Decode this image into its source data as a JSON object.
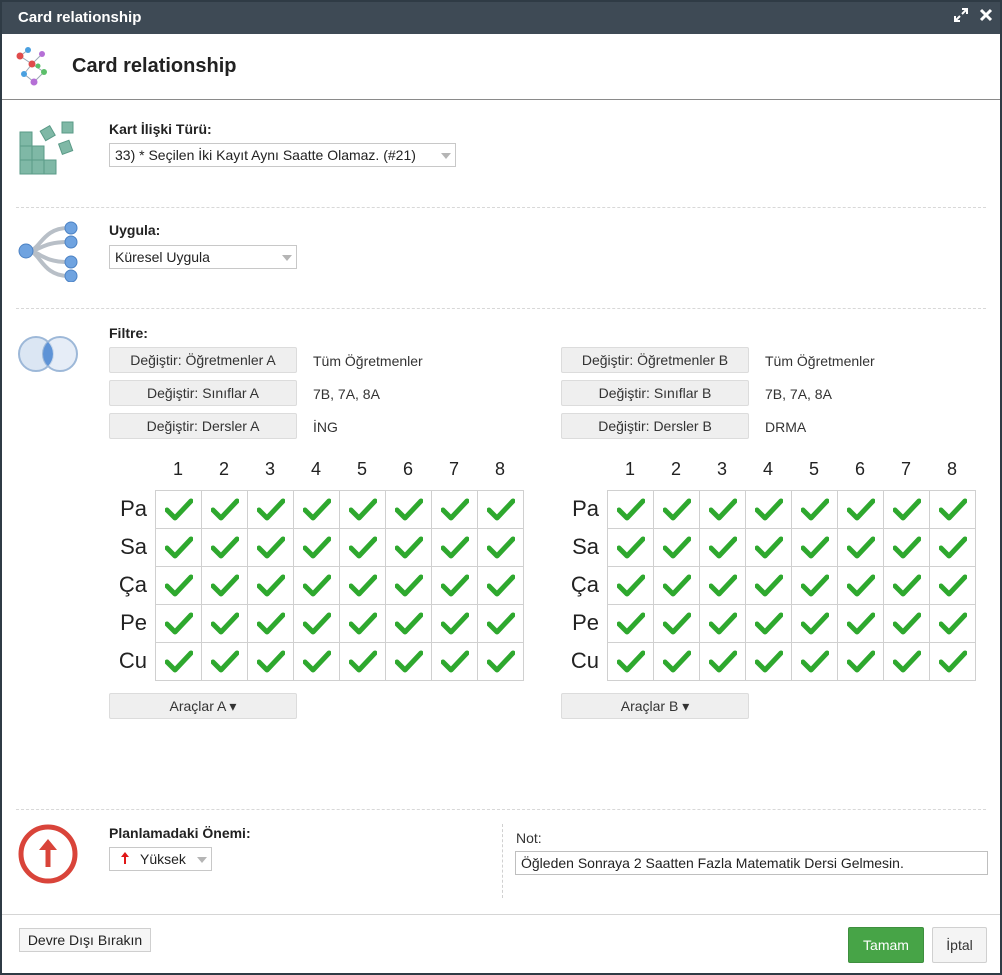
{
  "window": {
    "title": "Card relationship"
  },
  "header": {
    "title": "Card relationship"
  },
  "relation_type": {
    "label": "Kart İlişki Türü:",
    "selected": "33) * Seçilen İki Kayıt Aynı Saatte Olamaz. (#21)"
  },
  "apply": {
    "label": "Uygula:",
    "selected": "Küresel Uygula"
  },
  "filter": {
    "label": "Filtre:",
    "a": {
      "teachers_button": "Değiştir: Öğretmenler A",
      "teachers_value": "Tüm Öğretmenler",
      "classes_button": "Değiştir: Sınıflar A",
      "classes_value": "7B, 7A, 8A",
      "subjects_button": "Değiştir: Dersler A",
      "subjects_value": "İNG",
      "tools_button": "Araçlar A ▾"
    },
    "b": {
      "teachers_button": "Değiştir: Öğretmenler B",
      "teachers_value": "Tüm Öğretmenler",
      "classes_button": "Değiştir: Sınıflar B",
      "classes_value": "7B, 7A, 8A",
      "subjects_button": "Değiştir: Dersler B",
      "subjects_value": "DRMA",
      "tools_button": "Araçlar B ▾"
    }
  },
  "grid": {
    "periods": [
      "1",
      "2",
      "3",
      "4",
      "5",
      "6",
      "7",
      "8"
    ],
    "days": [
      "Pa",
      "Sa",
      "Ça",
      "Pe",
      "Cu"
    ],
    "a_checked": [
      [
        true,
        true,
        true,
        true,
        true,
        true,
        true,
        true
      ],
      [
        true,
        true,
        true,
        true,
        true,
        true,
        true,
        true
      ],
      [
        true,
        true,
        true,
        true,
        true,
        true,
        true,
        true
      ],
      [
        true,
        true,
        true,
        true,
        true,
        true,
        true,
        true
      ],
      [
        true,
        true,
        true,
        true,
        true,
        true,
        true,
        true
      ]
    ],
    "b_checked": [
      [
        true,
        true,
        true,
        true,
        true,
        true,
        true,
        true
      ],
      [
        true,
        true,
        true,
        true,
        true,
        true,
        true,
        true
      ],
      [
        true,
        true,
        true,
        true,
        true,
        true,
        true,
        true
      ],
      [
        true,
        true,
        true,
        true,
        true,
        true,
        true,
        true
      ],
      [
        true,
        true,
        true,
        true,
        true,
        true,
        true,
        true
      ]
    ],
    "check_color": "#2ea82e"
  },
  "importance": {
    "label": "Planlamadaki Önemi:",
    "selected": "Yüksek"
  },
  "note": {
    "label": "Not:",
    "value": "Öğleden Sonraya 2 Saatten Fazla Matematik Dersi Gelmesin."
  },
  "footer": {
    "disable_button": "Devre Dışı Bırakın",
    "ok_button": "Tamam",
    "cancel_button": "İptal"
  },
  "colors": {
    "titlebar": "#3e4a55",
    "ok_button": "#47a447",
    "importance_icon": "#d9443a"
  }
}
